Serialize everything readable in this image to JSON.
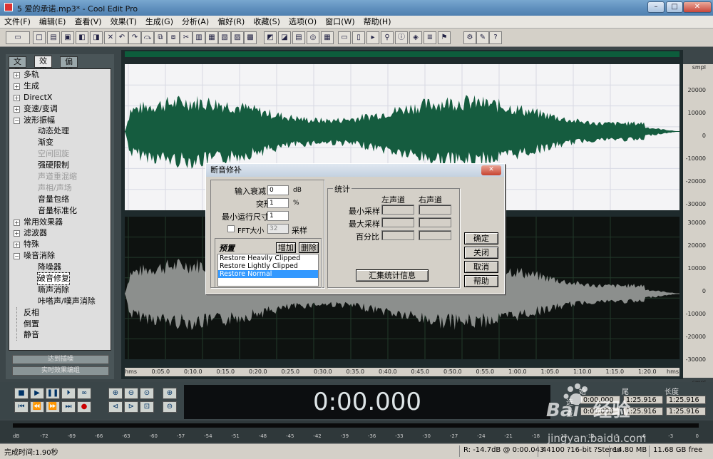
{
  "window": {
    "title": "5 爱的承诺.mp3* - Cool Edit Pro",
    "min": "–",
    "max": "□",
    "close": "✕"
  },
  "menu": [
    "文件(F)",
    "编辑(E)",
    "查看(V)",
    "效果(T)",
    "生成(G)",
    "分析(A)",
    "偏好(R)",
    "收藏(S)",
    "选项(O)",
    "窗口(W)",
    "帮助(H)"
  ],
  "panel": {
    "tabs": [
      "文件",
      "效果",
      "偏好"
    ],
    "tree": [
      {
        "label": "多轨",
        "level": 0,
        "exp": "+"
      },
      {
        "label": "生成",
        "level": 0,
        "exp": "+"
      },
      {
        "label": "DirectX",
        "level": 0,
        "exp": "+"
      },
      {
        "label": "变速/变调",
        "level": 0,
        "exp": "+"
      },
      {
        "label": "波形振幅",
        "level": 0,
        "exp": "-"
      },
      {
        "label": "动态处理",
        "level": 1
      },
      {
        "label": "渐变",
        "level": 1
      },
      {
        "label": "空间回旋",
        "level": 1,
        "dis": true
      },
      {
        "label": "强硬限制",
        "level": 1
      },
      {
        "label": "声道重混缩",
        "level": 1,
        "dis": true
      },
      {
        "label": "声相/声场",
        "level": 1,
        "dis": true
      },
      {
        "label": "音量包络",
        "level": 1
      },
      {
        "label": "音量标准化",
        "level": 1
      },
      {
        "label": "常用效果器",
        "level": 0,
        "exp": "+"
      },
      {
        "label": "滤波器",
        "level": 0,
        "exp": "+"
      },
      {
        "label": "特殊",
        "level": 0,
        "exp": "+"
      },
      {
        "label": "噪音消除",
        "level": 0,
        "exp": "-"
      },
      {
        "label": "降噪器",
        "level": 1
      },
      {
        "label": "破音修复",
        "level": 1,
        "sel": true
      },
      {
        "label": "嘶声消除",
        "level": 1
      },
      {
        "label": "咔嗒声/噗声消除",
        "level": 1
      },
      {
        "label": "反相",
        "level": 0
      },
      {
        "label": "倒置",
        "level": 0
      },
      {
        "label": "静音",
        "level": 0
      }
    ],
    "btn1": "达到插噪",
    "btn2": "实时效果编组"
  },
  "scale": {
    "top": [
      "smpl",
      "20000",
      "10000",
      "0",
      "-10000",
      "-20000",
      "-30000"
    ],
    "bottom": [
      "30000",
      "20000",
      "10000",
      "0",
      "-10000",
      "-20000",
      "-30000",
      "smpl"
    ]
  },
  "ruler": [
    "hms",
    "0:05.0",
    "0:10.0",
    "0:15.0",
    "0:20.0",
    "0:25.0",
    "0:30.0",
    "0:35.0",
    "0:40.0",
    "0:45.0",
    "0:50.0",
    "0:55.0",
    "1:00.0",
    "1:05.0",
    "1:10.0",
    "1:15.0",
    "1:20.0",
    "hms"
  ],
  "dialog": {
    "title": "断音修补",
    "close": "✕",
    "in_atten_label": "输入衰减",
    "in_atten": "0",
    "unit_db": "dB",
    "spike_label": "突形",
    "spike": "1",
    "unit_pct": "%",
    "minrun_label": "最小运行尺寸",
    "minrun": "1",
    "fft_label": "FFT大小",
    "fft": "32",
    "fft_unit": "采样",
    "preset_title": "预置",
    "add": "增加",
    "del": "删除",
    "presets": [
      "Restore Heavily Clipped",
      "Restore Lightly Clipped",
      "Restore Normal"
    ],
    "stats_title": "统计",
    "left_ch": "左声道",
    "right_ch": "右声道",
    "min_sample": "最小采样",
    "max_sample": "最大采样",
    "pct": "百分比",
    "gather": "汇集统计信息",
    "ok": "确定",
    "close_btn": "关闭",
    "cancel": "取消",
    "help": "帮助"
  },
  "time": "0:00.000",
  "sel": {
    "begin": "始",
    "end": "尾",
    "len": "长度",
    "sel_lbl": "选",
    "view_lbl": "查",
    "b1": "0:00.000",
    "e1": "1:25.916",
    "l1": "1:25.916",
    "b2": "0:00.000",
    "e2": "1:25.916",
    "l2": "1:25.916"
  },
  "meter": [
    "dB",
    "-72",
    "-69",
    "-66",
    "-63",
    "-60",
    "-57",
    "-54",
    "-51",
    "-48",
    "-45",
    "-42",
    "-39",
    "-36",
    "-33",
    "-30",
    "-27",
    "-24",
    "-21",
    "-18",
    "-15",
    "-12",
    "-9",
    "-6",
    "-3",
    "0"
  ],
  "status": {
    "done": "完成时间:1.90秒",
    "r": "R: -14.7dB @ 0:00.043",
    "fmt": "44100 ?16-bit ?Stereo",
    "size": "14.80 MB",
    "free": "11.68 GB free"
  },
  "watermark": "Baidu经验",
  "watermark_url": "jingyan.baidu.com"
}
